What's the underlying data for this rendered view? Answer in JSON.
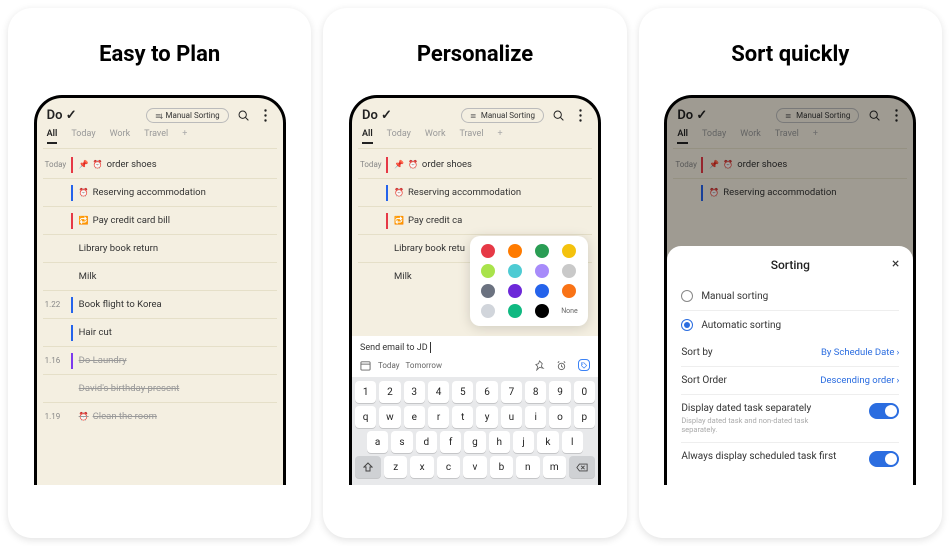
{
  "panels": [
    "Easy to Plan",
    "Personalize",
    "Sort quickly"
  ],
  "logo": "Do ✓",
  "sort_chip": "Manual Sorting",
  "tabs": {
    "all": "All",
    "today": "Today",
    "work": "Work",
    "travel": "Travel"
  },
  "groups": {
    "today": "Today",
    "d122": "1.22",
    "d116": "1.16",
    "d119": "1.19"
  },
  "tasks": {
    "t1": "order shoes",
    "t2": "Reserving accommodation",
    "t3": "Pay credit card bill",
    "t3b": "Pay credit ca",
    "t4": "Library book return",
    "t4b": "Library book retu",
    "t5": "Milk",
    "t6": "Book flight to Korea",
    "t7": "Hair cut",
    "t8": "Do Laundry",
    "t9": "David's birthday present",
    "t10": "Clean the room"
  },
  "input_text": "Send email to JD",
  "toolbar": {
    "today": "Today",
    "tomorrow": "Tomorrow"
  },
  "keyboard": {
    "nums": [
      "1",
      "2",
      "3",
      "4",
      "5",
      "6",
      "7",
      "8",
      "9",
      "0"
    ],
    "row1": [
      "q",
      "w",
      "e",
      "r",
      "t",
      "y",
      "u",
      "i",
      "o",
      "p"
    ],
    "row2": [
      "a",
      "s",
      "d",
      "f",
      "g",
      "h",
      "j",
      "k",
      "l"
    ],
    "row3": [
      "z",
      "x",
      "c",
      "v",
      "b",
      "n",
      "m"
    ]
  },
  "colors": [
    "#e63946",
    "#ff7b00",
    "#2a9d54",
    "#f4c20d",
    "#a9e34b",
    "#4ecbd3",
    "#a78bfa",
    "#c9c9c9",
    "#6b7280",
    "#6d28d9",
    "#2563eb",
    "#f97316",
    "#d1d5db",
    "#10b981",
    "#000000"
  ],
  "none_label": "None",
  "sheet": {
    "title": "Sorting",
    "manual": "Manual sorting",
    "auto": "Automatic sorting",
    "sort_by_label": "Sort by",
    "sort_by_value": "By Schedule Date",
    "sort_order_label": "Sort Order",
    "sort_order_value": "Descending order",
    "toggle1_label": "Display dated task separately",
    "toggle1_desc": "Display dated task and non-dated task separately.",
    "toggle2_label": "Always display scheduled task first"
  }
}
